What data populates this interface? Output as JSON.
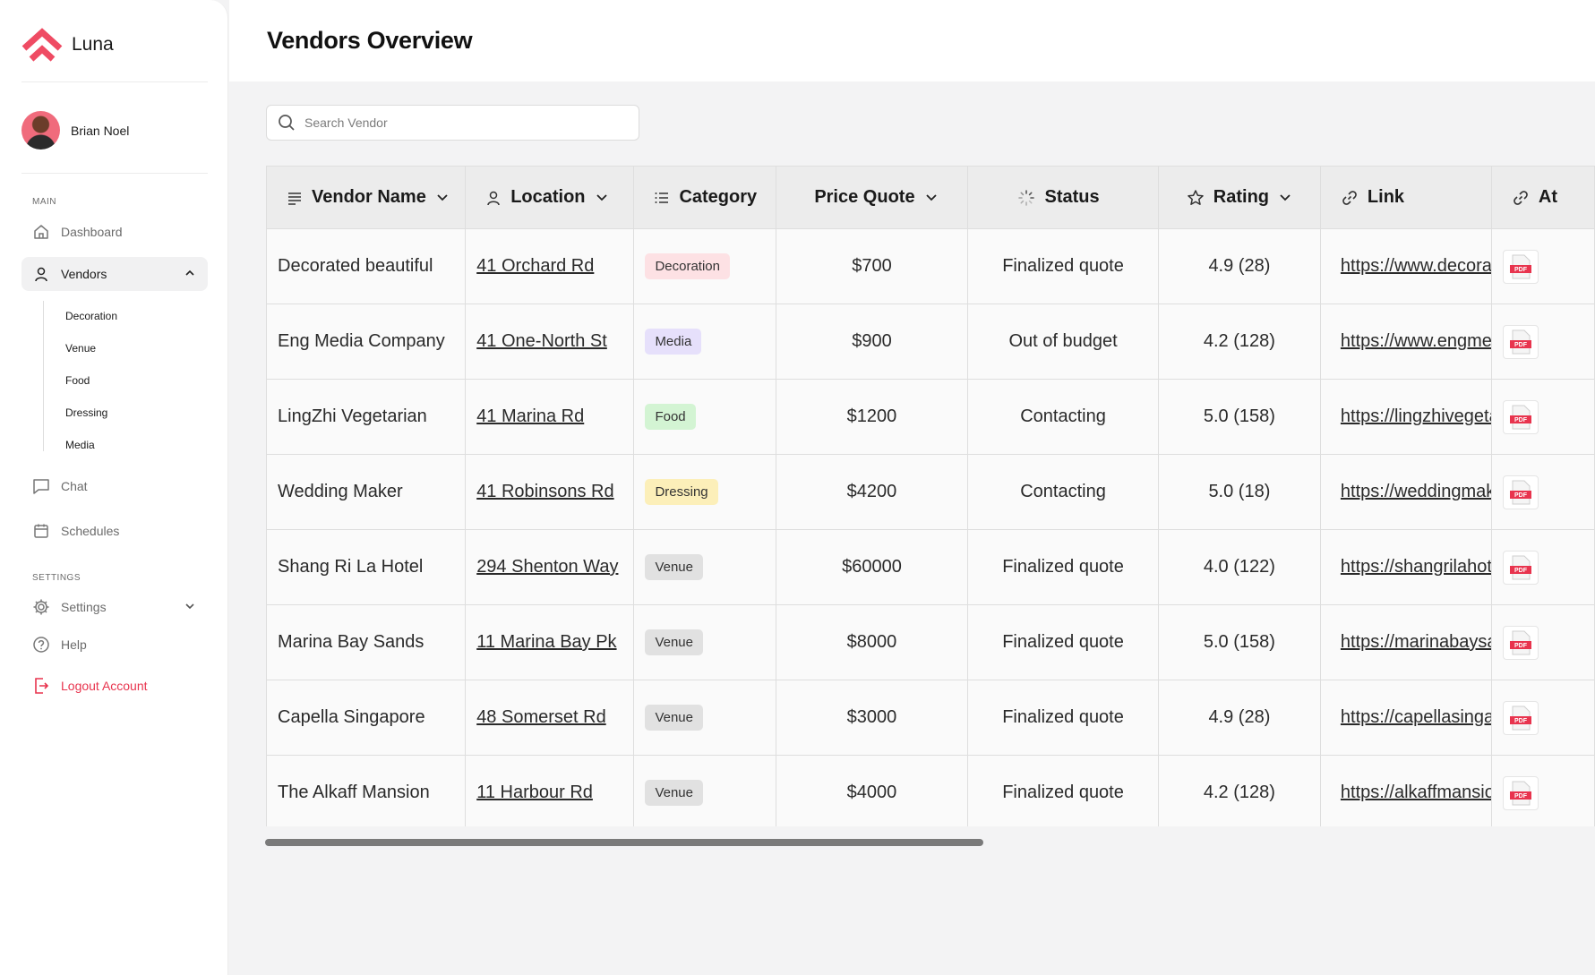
{
  "brand": {
    "name": "Luna",
    "color": "#ef4b63"
  },
  "user": {
    "name": "Brian Noel"
  },
  "sidebar": {
    "main_label": "MAIN",
    "settings_label": "SETTINGS",
    "dashboard": "Dashboard",
    "vendors": "Vendors",
    "sub_items": [
      "Decoration",
      "Venue",
      "Food",
      "Dressing",
      "Media"
    ],
    "chat": "Chat",
    "schedules": "Schedules",
    "settings": "Settings",
    "help": "Help",
    "logout": "Logout Account"
  },
  "header": {
    "title": "Vendors Overview"
  },
  "search": {
    "placeholder": "Search Vendor"
  },
  "table": {
    "columns": {
      "vendor_name": "Vendor Name",
      "location": "Location",
      "category": "Category",
      "price_quote": "Price Quote",
      "status": "Status",
      "rating": "Rating",
      "link": "Link",
      "attachment": "At"
    },
    "category_colors": {
      "Decoration": "#fde1e4",
      "Media": "#e6e0fb",
      "Food": "#d3f4d3",
      "Dressing": "#fcefb9",
      "Venue": "#e1e1e1"
    },
    "rows": [
      {
        "name": "Decorated beautiful",
        "location": "41 Orchard Rd",
        "category": "Decoration",
        "price": "$700",
        "status": "Finalized quote",
        "rating": "4.9 (28)",
        "link": "https://www.decorated"
      },
      {
        "name": "Eng Media Company",
        "location": "41 One-North St",
        "category": "Media",
        "price": "$900",
        "status": "Out of budget",
        "rating": "4.2 (128)",
        "link": "https://www.engmedia"
      },
      {
        "name": "LingZhi Vegetarian",
        "location": "41 Marina Rd",
        "category": "Food",
        "price": "$1200",
        "status": "Contacting",
        "rating": "5.0 (158)",
        "link": "https://lingzhivegetarian"
      },
      {
        "name": "Wedding Maker",
        "location": "41 Robinsons Rd",
        "category": "Dressing",
        "price": "$4200",
        "status": "Contacting",
        "rating": "5.0 (18)",
        "link": "https://weddingmaker"
      },
      {
        "name": "Shang Ri La Hotel",
        "location": "294 Shenton Way",
        "category": "Venue",
        "price": "$60000",
        "status": "Finalized quote",
        "rating": "4.0 (122)",
        "link": "https://shangrilahotel"
      },
      {
        "name": "Marina Bay Sands",
        "location": "11 Marina Bay Pk",
        "category": "Venue",
        "price": "$8000",
        "status": "Finalized quote",
        "rating": "5.0 (158)",
        "link": "https://marinabaysands"
      },
      {
        "name": "Capella Singapore",
        "location": "48 Somerset Rd",
        "category": "Venue",
        "price": "$3000",
        "status": "Finalized quote",
        "rating": "4.9 (28)",
        "link": "https://capellasingapore"
      },
      {
        "name": "The Alkaff Mansion",
        "location": "11 Harbour Rd",
        "category": "Venue",
        "price": "$4000",
        "status": "Finalized quote",
        "rating": "4.2 (128)",
        "link": "https://alkaffmansion"
      }
    ],
    "attachment_label": "PDF"
  }
}
